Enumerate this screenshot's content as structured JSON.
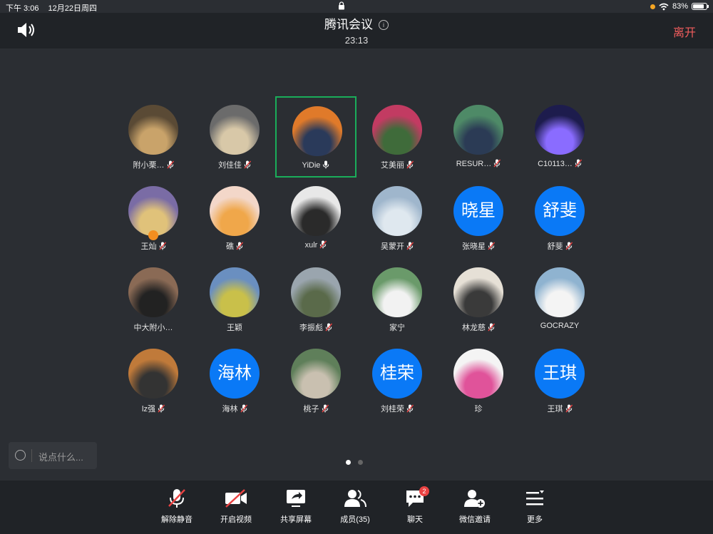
{
  "status_bar": {
    "time": "下午 3:06",
    "date": "12月22日周四",
    "battery": "83%",
    "battery_level": 0.83
  },
  "header": {
    "title": "腾讯会议",
    "timer": "23:13",
    "leave_label": "离开"
  },
  "participants": [
    {
      "name": "附小栗…",
      "mic": "muted",
      "avatar_kind": "photo",
      "bg": "#5a4a35",
      "fg": "#c9a36a"
    },
    {
      "name": "刘佳佳",
      "mic": "muted",
      "avatar_kind": "photo",
      "bg": "#6b6b6b",
      "fg": "#d8c8a8"
    },
    {
      "name": "YiDie",
      "mic": "on",
      "active": true,
      "avatar_kind": "photo",
      "bg": "#e07a2a",
      "fg": "#2a3a5a"
    },
    {
      "name": "艾美丽",
      "mic": "muted",
      "avatar_kind": "photo",
      "bg": "#c23b62",
      "fg": "#3f6b3a"
    },
    {
      "name": "RESUR…",
      "mic": "muted",
      "avatar_kind": "photo",
      "bg": "#4e8a67",
      "fg": "#2b3b55"
    },
    {
      "name": "C10113…",
      "mic": "muted",
      "avatar_kind": "photo",
      "bg": "#1d1c4d",
      "fg": "#8a6cff"
    },
    {
      "name": "王灿",
      "mic": "muted",
      "host": true,
      "avatar_kind": "photo",
      "bg": "#7a6ca5",
      "fg": "#e0c27a"
    },
    {
      "name": "礁",
      "mic": "muted",
      "avatar_kind": "photo",
      "bg": "#f3d7c9",
      "fg": "#f0a74a"
    },
    {
      "name": "xulr",
      "mic": "muted",
      "avatar_kind": "photo",
      "bg": "#e8e8e8",
      "fg": "#2a2a2a"
    },
    {
      "name": "吴蒙开",
      "mic": "muted",
      "avatar_kind": "photo",
      "bg": "#9fb6cc",
      "fg": "#dfe8ef"
    },
    {
      "name": "张晓星",
      "mic": "muted",
      "avatar_kind": "text",
      "avatar_text": "晓星"
    },
    {
      "name": "舒斐",
      "mic": "muted",
      "avatar_kind": "text",
      "avatar_text": "舒斐"
    },
    {
      "name": "中大附小…",
      "mic": "none",
      "avatar_kind": "photo",
      "bg": "#8a6a55",
      "fg": "#222222"
    },
    {
      "name": "王颖",
      "mic": "none",
      "avatar_kind": "photo",
      "bg": "#6a8fc0",
      "fg": "#c9c04a"
    },
    {
      "name": "李振彪",
      "mic": "muted",
      "avatar_kind": "photo",
      "bg": "#9aa5ae",
      "fg": "#5a6a4a"
    },
    {
      "name": "家宁",
      "mic": "none",
      "avatar_kind": "photo",
      "bg": "#6a9a6a",
      "fg": "#f2f2f2"
    },
    {
      "name": "林龙慈",
      "mic": "muted",
      "avatar_kind": "photo",
      "bg": "#e6e0d6",
      "fg": "#3a3a3a"
    },
    {
      "name": "GOCRAZY",
      "mic": "none",
      "avatar_kind": "photo",
      "bg": "#8fb3d0",
      "fg": "#f4f4f4"
    },
    {
      "name": "lz强",
      "mic": "muted",
      "avatar_kind": "photo",
      "bg": "#c07a3a",
      "fg": "#333333"
    },
    {
      "name": "海林",
      "mic": "muted",
      "avatar_kind": "text",
      "avatar_text": "海林"
    },
    {
      "name": "桃子",
      "mic": "muted",
      "avatar_kind": "photo",
      "bg": "#5f7f5a",
      "fg": "#c9c0b0"
    },
    {
      "name": "刘桂荣",
      "mic": "muted",
      "avatar_kind": "text",
      "avatar_text": "桂荣"
    },
    {
      "name": "珍",
      "mic": "none",
      "avatar_kind": "photo",
      "bg": "#f4f4f4",
      "fg": "#e0539a"
    },
    {
      "name": "王琪",
      "mic": "muted",
      "avatar_kind": "text",
      "avatar_text": "王琪"
    }
  ],
  "chat": {
    "placeholder": "说点什么..."
  },
  "pager": {
    "pages": 2,
    "current": 1
  },
  "toolbar": {
    "unmute": "解除静音",
    "video": "开启视频",
    "share": "共享屏幕",
    "members": "成员(35)",
    "chat": "聊天",
    "chat_badge": "2",
    "invite": "微信邀请",
    "more": "更多"
  },
  "colors": {
    "accent_blue": "#0a79f6",
    "active_border": "#1aad5a",
    "leave_red": "#f25d5d",
    "mute_red": "#e94242"
  }
}
